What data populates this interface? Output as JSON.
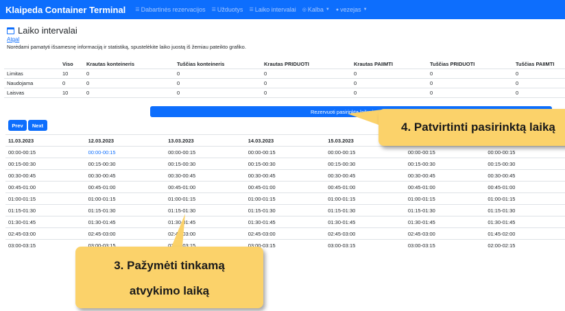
{
  "nav": {
    "brand": "Klaipeda Container Terminal",
    "items": [
      {
        "icon": "list-icon",
        "label": "Dabartinės rezervacijos",
        "dropdown": false
      },
      {
        "icon": "list-icon",
        "label": "Užduotys",
        "dropdown": false
      },
      {
        "icon": "list-icon",
        "label": "Laiko intervalai",
        "dropdown": false
      },
      {
        "icon": "globe-icon",
        "label": "Kalba",
        "dropdown": true
      },
      {
        "icon": "user-icon",
        "label": "vezejas",
        "dropdown": true
      }
    ]
  },
  "page": {
    "title": "Laiko intervalai",
    "back": "Atgal",
    "info": "Norėdami pamatyti išsamesnę informaciją ir statistiką, spustelėkite laiko juostą iš žemiau pateikto grafiko."
  },
  "summary": {
    "headers": [
      "",
      "Viso",
      "Krautas konteineris",
      "Tuščias konteineris",
      "Krautas PRIDUOTI",
      "Krautas PAIIMTI",
      "Tuščias PRIDUOTI",
      "Tuščias PAIIMTI"
    ],
    "rows": [
      [
        "Limitas",
        "10",
        "0",
        "0",
        "0",
        "0",
        "0",
        "0"
      ],
      [
        "Naudojama",
        "0",
        "0",
        "0",
        "0",
        "0",
        "0",
        "0"
      ],
      [
        "Laisvas",
        "10",
        "0",
        "0",
        "0",
        "0",
        "0",
        "0"
      ]
    ]
  },
  "reserve_button": "Rezervuoti pasirinktą laiko intervalą",
  "pagination": {
    "prev": "Prev",
    "next": "Next"
  },
  "schedule": {
    "dates": [
      "11.03.2023",
      "12.03.2023",
      "13.03.2023",
      "14.03.2023",
      "15.03.2023",
      "",
      ""
    ],
    "selected": {
      "row": 0,
      "col": 1
    },
    "rows": [
      [
        "00:00-00:15",
        "00:00-00:15",
        "00:00-00:15",
        "00:00-00:15",
        "00:00-00:15",
        "00:00-00:15",
        "00:00-00:15"
      ],
      [
        "00:15-00:30",
        "00:15-00:30",
        "00:15-00:30",
        "00:15-00:30",
        "00:15-00:30",
        "00:15-00:30",
        "00:15-00:30"
      ],
      [
        "00:30-00:45",
        "00:30-00:45",
        "00:30-00:45",
        "00:30-00:45",
        "00:30-00:45",
        "00:30-00:45",
        "00:30-00:45"
      ],
      [
        "00:45-01:00",
        "00:45-01:00",
        "00:45-01:00",
        "00:45-01:00",
        "00:45-01:00",
        "00:45-01:00",
        "00:45-01:00"
      ],
      [
        "01:00-01:15",
        "01:00-01:15",
        "01:00-01:15",
        "01:00-01:15",
        "01:00-01:15",
        "01:00-01:15",
        "01:00-01:15"
      ],
      [
        "01:15-01:30",
        "01:15-01:30",
        "01:15-01:30",
        "01:15-01:30",
        "01:15-01:30",
        "01:15-01:30",
        "01:15-01:30"
      ],
      [
        "01:30-01:45",
        "01:30-01:45",
        "01:30-01:45",
        "01:30-01:45",
        "01:30-01:45",
        "01:30-01:45",
        "01:30-01:45"
      ],
      [
        "02:45-03:00",
        "02:45-03:00",
        "02:45-03:00",
        "02:45-03:00",
        "02:45-03:00",
        "02:45-03:00",
        "01:45-02:00"
      ],
      [
        "03:00-03:15",
        "03:00-03:15",
        "03:00-03:15",
        "03:00-03:15",
        "03:00-03:15",
        "03:00-03:15",
        "02:00-02:15"
      ]
    ]
  },
  "callouts": {
    "step4": "4. Patvirtinti pasirinktą laiką",
    "step3_line1": "3. Pažymėti tinkamą",
    "step3_line2": "atvykimo laiką"
  },
  "colors": {
    "primary": "#0d6efd",
    "callout": "#fbd26a"
  }
}
